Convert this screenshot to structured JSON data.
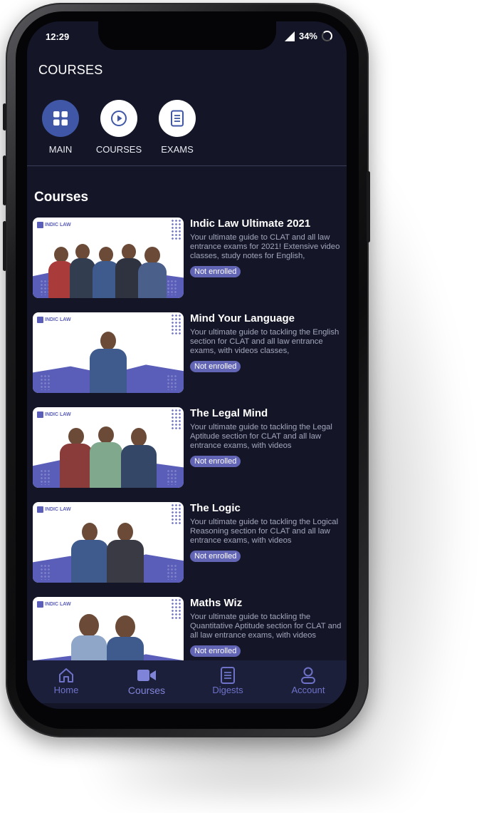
{
  "status": {
    "time": "12:29",
    "battery": "34%"
  },
  "appbar": {
    "title": "COURSES"
  },
  "quicknav": [
    {
      "label": "MAIN",
      "icon": "grid-icon"
    },
    {
      "label": "COURSES",
      "icon": "play-circle-icon"
    },
    {
      "label": "EXAMS",
      "icon": "document-icon"
    }
  ],
  "section": {
    "title": "Courses"
  },
  "thumb_logo": "INDIC LAW",
  "courses": [
    {
      "title": "Indic Law Ultimate 2021",
      "description": "Your ultimate guide to CLAT and all law entrance exams for 2021! Extensive video classes, study notes for English,",
      "status": "Not enrolled"
    },
    {
      "title": "Mind Your Language",
      "description": "Your ultimate guide to tackling the English section for CLAT and all law entrance exams, with videos classes,",
      "status": "Not enrolled"
    },
    {
      "title": "The Legal Mind",
      "description": "Your ultimate guide to tackling the Legal Aptitude section for CLAT and all law entrance exams, with videos",
      "status": "Not enrolled"
    },
    {
      "title": "The Logic",
      "description": "Your ultimate guide to tackling the Logical Reasoning section for CLAT and all law entrance exams, with videos",
      "status": "Not enrolled"
    },
    {
      "title": "Maths Wiz",
      "description": "Your ultimate guide to tackling the Quantitative Aptitude section for CLAT and all law entrance exams, with videos",
      "status": "Not enrolled"
    }
  ],
  "tabs": [
    {
      "label": "Home",
      "icon": "home-icon"
    },
    {
      "label": "Courses",
      "icon": "video-camera-icon",
      "active": true
    },
    {
      "label": "Digests",
      "icon": "digest-icon"
    },
    {
      "label": "Account",
      "icon": "account-icon"
    }
  ],
  "colors": {
    "background": "#141628",
    "accent": "#6264b4",
    "tabbar": "#1c1f3a"
  }
}
